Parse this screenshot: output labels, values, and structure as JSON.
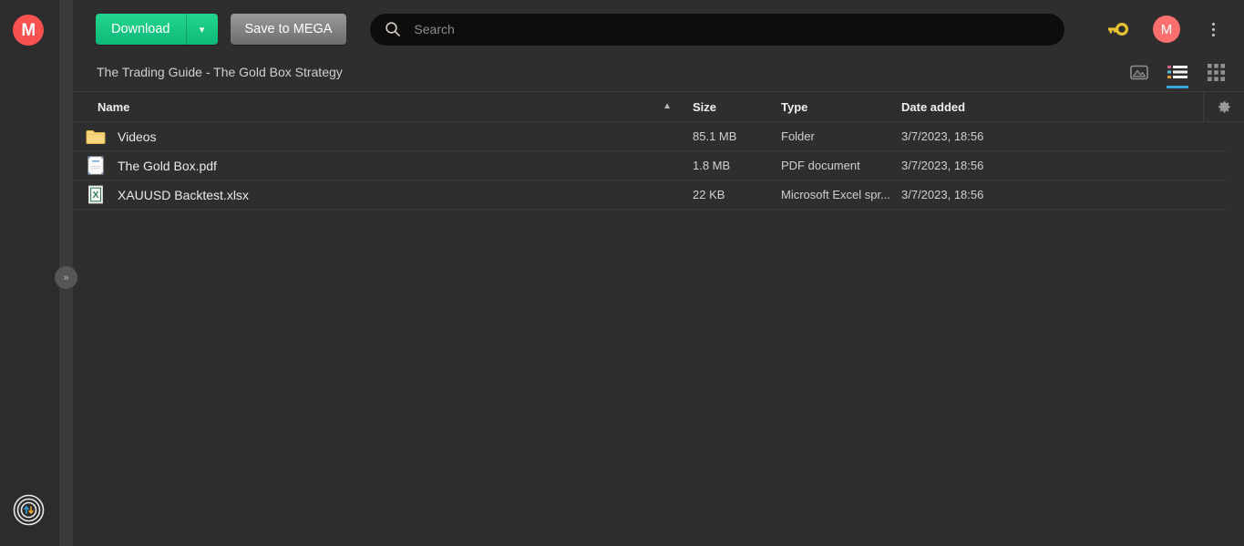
{
  "brand": {
    "logo_letter": "M",
    "logo_color": "#f9514f"
  },
  "toolbar": {
    "download_label": "Download",
    "download_caret_icon": "chevron-down-icon",
    "save_label": "Save to MEGA",
    "accent_green": "#17c98b",
    "save_gray": "#7f7f7f"
  },
  "search": {
    "placeholder": "Search",
    "value": "",
    "icon": "search-icon"
  },
  "account": {
    "key_icon": "key-icon",
    "avatar_letter": "M",
    "avatar_color": "#f9706e",
    "menu_icon": "vertical-dots-icon"
  },
  "breadcrumb": {
    "path": "The Trading Guide - The Gold Box Strategy"
  },
  "view_toggles": [
    {
      "name": "media-view",
      "icon": "image-icon",
      "active": false
    },
    {
      "name": "list-view",
      "icon": "list-icon",
      "active": true
    },
    {
      "name": "grid-view",
      "icon": "grid-icon",
      "active": false
    }
  ],
  "table": {
    "sort": {
      "column": "Name",
      "direction": "asc",
      "icon": "chevron-up-icon"
    },
    "settings_icon": "gear-icon",
    "columns": [
      {
        "key": "name",
        "label": "Name"
      },
      {
        "key": "size",
        "label": "Size"
      },
      {
        "key": "type",
        "label": "Type"
      },
      {
        "key": "date",
        "label": "Date added"
      }
    ],
    "rows": [
      {
        "icon": "folder-icon",
        "name": "Videos",
        "size": "85.1 MB",
        "type": "Folder",
        "date": "3/7/2023, 18:56"
      },
      {
        "icon": "pdf-icon",
        "name": "The Gold Box.pdf",
        "size": "1.8 MB",
        "type": "PDF document",
        "date": "3/7/2023, 18:56"
      },
      {
        "icon": "excel-icon",
        "name": "XAUUSD Backtest.xlsx",
        "size": "22 KB",
        "type": "Microsoft Excel spr...",
        "date": "3/7/2023, 18:56"
      }
    ]
  },
  "sidebar": {
    "expand_icon": "double-chevron-right-icon",
    "transfers_icon": "transfers-icon"
  }
}
